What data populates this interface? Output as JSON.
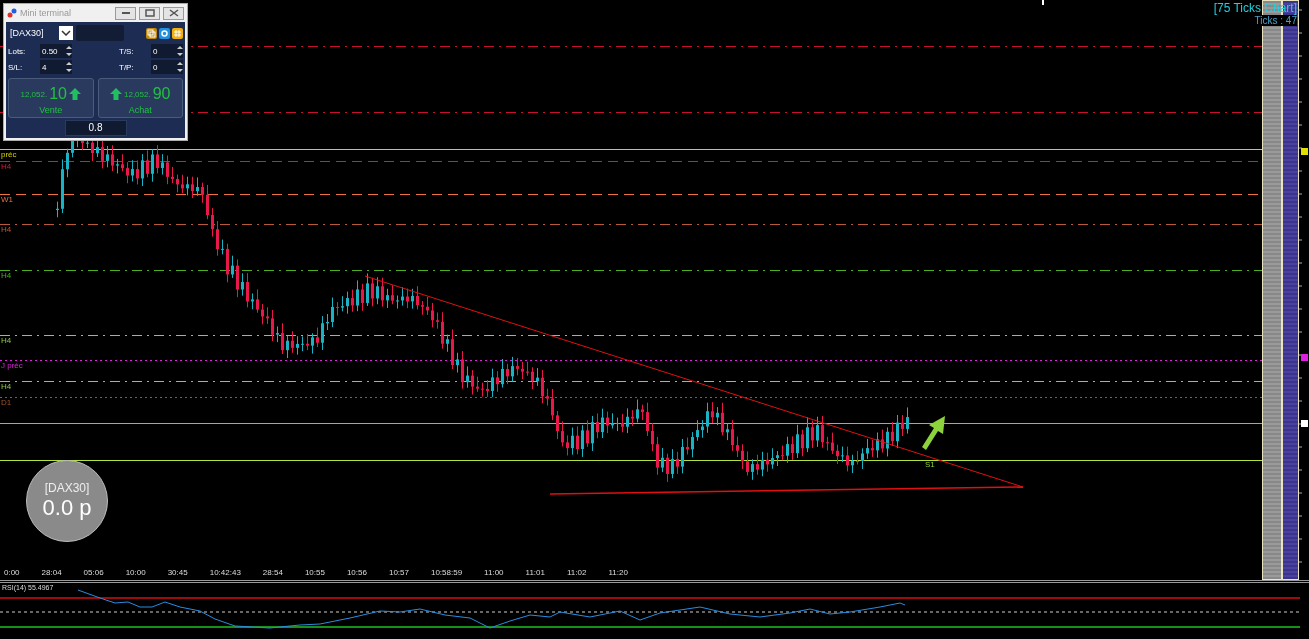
{
  "chart_header": {
    "title": "[75 Ticks Chart]",
    "ticks": "Ticks : 47"
  },
  "levels": [
    {
      "color": "#c8102e",
      "kind": "dashdot"
    },
    {
      "color": "#c8102e",
      "kind": "dashdot"
    },
    {
      "label": "préc",
      "color": "#d4d400",
      "kind": "solid"
    },
    {
      "label": "H4",
      "color": "#d81b3c",
      "kind": "dashed"
    },
    {
      "label": "W1",
      "color": "#f07040",
      "kind": "dashed"
    },
    {
      "label": "H4",
      "color": "#b85a3a",
      "kind": "dashdot"
    },
    {
      "label": "H4",
      "color": "#4caf20",
      "kind": "dashdot"
    },
    {
      "label": "H4",
      "color": "#8bd23a",
      "kind": "dashdot"
    },
    {
      "label": "J préc",
      "color": "#e020e0",
      "kind": "dotted"
    },
    {
      "label": "H4",
      "color": "#8bd23a",
      "kind": "dashdot"
    },
    {
      "label": "D1",
      "color": "#a0522d",
      "kind": "dotted"
    },
    {
      "color": "#a8a890",
      "kind": "solid"
    },
    {
      "color": "#b4e040",
      "kind": "solid"
    }
  ],
  "support_label": "S1",
  "time_axis": [
    "0:00",
    "28:04",
    "05:06",
    "10:00",
    "30:45",
    "10:42:43",
    "28:54",
    "10:55",
    "10:56",
    "10:57",
    "10:58:59",
    "11:00",
    "11:01",
    "11:02",
    "11:20"
  ],
  "rsi": {
    "label": "RSI(14) 55.4967"
  },
  "widget": {
    "symbol": "[DAX30]",
    "value": "0.0 p"
  },
  "terminal": {
    "title": "Mini terminal",
    "symbol": "[DAX30]",
    "fields": [
      {
        "label": "Lots:",
        "value": "0.50"
      },
      {
        "label": "T/S:",
        "value": "0"
      },
      {
        "label": "S/L:",
        "value": "4"
      },
      {
        "label": "T/P:",
        "value": "0"
      }
    ],
    "sell": {
      "small": "12,052.",
      "big": "10",
      "label": "Vente"
    },
    "buy": {
      "small": "12,052.",
      "big": "90",
      "label": "Achat"
    },
    "spread": "0.8"
  }
}
